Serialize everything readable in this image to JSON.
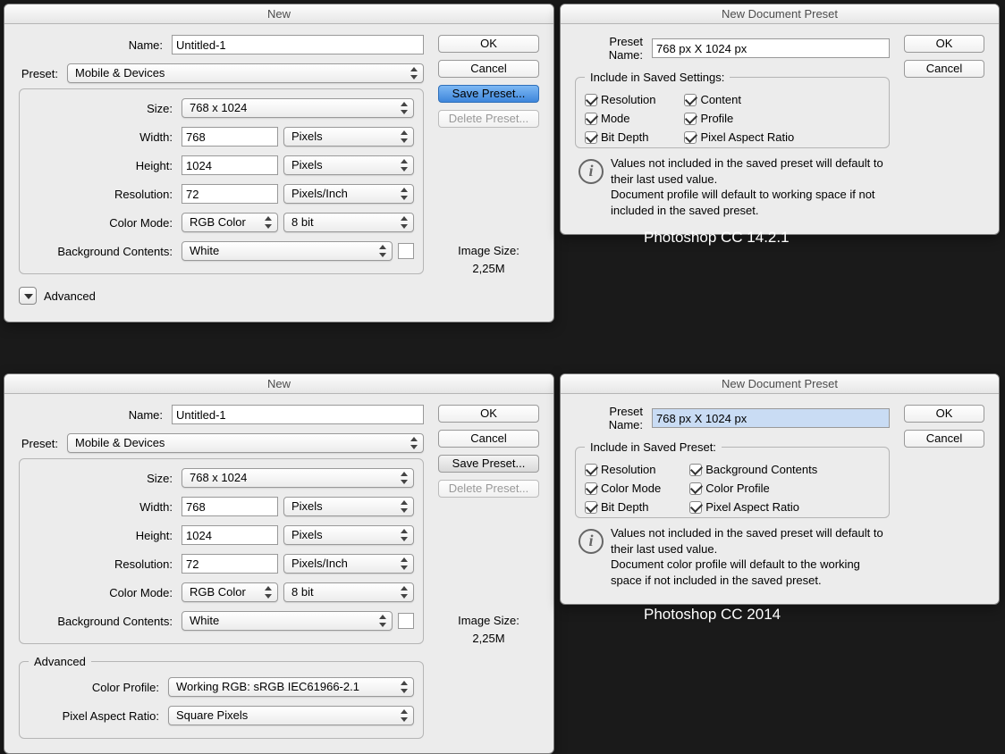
{
  "top": {
    "new": {
      "title": "New",
      "name_label": "Name:",
      "name_value": "Untitled-1",
      "preset_label": "Preset:",
      "preset_value": "Mobile & Devices",
      "size_label": "Size:",
      "size_value": "768 x 1024",
      "width_label": "Width:",
      "width_value": "768",
      "width_unit": "Pixels",
      "height_label": "Height:",
      "height_value": "1024",
      "height_unit": "Pixels",
      "resolution_label": "Resolution:",
      "resolution_value": "72",
      "resolution_unit": "Pixels/Inch",
      "colormode_label": "Color Mode:",
      "colormode_value": "RGB Color",
      "colordepth_value": "8 bit",
      "bg_label": "Background Contents:",
      "bg_value": "White",
      "advanced_label": "Advanced",
      "ok": "OK",
      "cancel": "Cancel",
      "save_preset": "Save Preset...",
      "delete_preset": "Delete Preset...",
      "image_size_label": "Image Size:",
      "image_size_value": "2,25M"
    },
    "preset": {
      "title": "New Document Preset",
      "name_label": "Preset Name:",
      "name_value": "768 px X 1024 px",
      "legend": "Include in Saved Settings:",
      "checks": {
        "resolution": "Resolution",
        "mode": "Mode",
        "bitdepth": "Bit Depth",
        "content": "Content",
        "profile": "Profile",
        "par": "Pixel Aspect Ratio"
      },
      "ok": "OK",
      "cancel": "Cancel",
      "info": "Values not included in the saved preset will default to their last used value.\nDocument profile will default to working space if not included in the saved preset."
    },
    "version": "Photoshop CC 14.2.1"
  },
  "bottom": {
    "new": {
      "title": "New",
      "name_label": "Name:",
      "name_value": "Untitled-1",
      "preset_label": "Preset:",
      "preset_value": "Mobile & Devices",
      "size_label": "Size:",
      "size_value": "768 x 1024",
      "width_label": "Width:",
      "width_value": "768",
      "width_unit": "Pixels",
      "height_label": "Height:",
      "height_value": "1024",
      "height_unit": "Pixels",
      "resolution_label": "Resolution:",
      "resolution_value": "72",
      "resolution_unit": "Pixels/Inch",
      "colormode_label": "Color Mode:",
      "colormode_value": "RGB Color",
      "colordepth_value": "8 bit",
      "bg_label": "Background Contents:",
      "bg_value": "White",
      "advanced_legend": "Advanced",
      "color_profile_label": "Color Profile:",
      "color_profile_value": "Working RGB:  sRGB IEC61966-2.1",
      "par_label": "Pixel Aspect Ratio:",
      "par_value": "Square Pixels",
      "ok": "OK",
      "cancel": "Cancel",
      "save_preset": "Save Preset...",
      "delete_preset": "Delete Preset...",
      "image_size_label": "Image Size:",
      "image_size_value": "2,25M"
    },
    "preset": {
      "title": "New Document Preset",
      "name_label": "Preset Name:",
      "name_value": "768 px X 1024 px",
      "legend": "Include in Saved Preset:",
      "checks": {
        "resolution": "Resolution",
        "colormode": "Color Mode",
        "bitdepth": "Bit Depth",
        "bgcontents": "Background Contents",
        "colorprofile": "Color Profile",
        "par": "Pixel Aspect Ratio"
      },
      "ok": "OK",
      "cancel": "Cancel",
      "info": "Values not included in the saved preset will default to their last used value.\nDocument color profile will default to the working space if not included in the saved preset."
    },
    "version": "Photoshop CC 2014"
  }
}
